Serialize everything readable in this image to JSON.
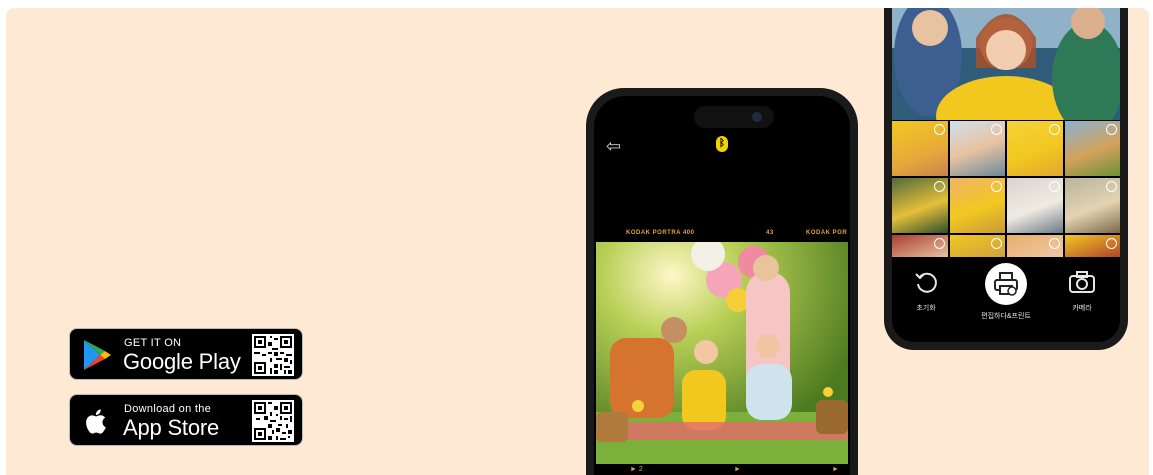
{
  "google_play": {
    "small": "GET IT ON",
    "big": "Google Play",
    "logo": "google-play-icon",
    "qr": "qr-code-icon"
  },
  "app_store": {
    "small": "Download on the",
    "big": "App Store",
    "logo": "apple-icon",
    "qr": "qr-code-icon"
  },
  "phone1": {
    "back_icon": "back-arrow-icon",
    "bluetooth_icon": "bluetooth-icon",
    "film_left": "KODAK PORTRA 400",
    "film_mid": "43",
    "film_right": "KODAK POR",
    "frame_left": "► 2",
    "frame_mid": "►",
    "frame_right": "►"
  },
  "phone2": {
    "reset_label": "초기화",
    "edit_print_label": "편집하다&프린트",
    "camera_label": "카메라",
    "icons": [
      "reset-icon",
      "printer-icon",
      "camera-icon"
    ]
  },
  "colors": {
    "background": "#fde9d4",
    "badge": "#000000",
    "accent_yellow": "#f2c81f"
  }
}
